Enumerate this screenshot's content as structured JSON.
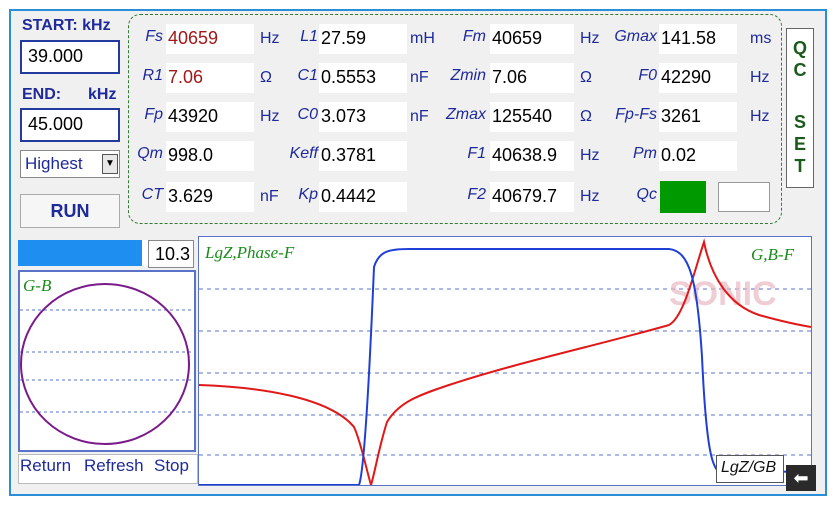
{
  "sweep": {
    "start_label": "START: kHz",
    "start_value": "39.000",
    "end_label": "END:",
    "end_unit": "kHz",
    "end_value": "45.000",
    "mode_selected": "Highest",
    "run_label": "RUN"
  },
  "params": [
    {
      "key": "fs",
      "label": "Fs",
      "value": "40659",
      "unit": "Hz"
    },
    {
      "key": "r1",
      "label": "R1",
      "value": "7.06",
      "unit": "Ω"
    },
    {
      "key": "fp",
      "label": "Fp",
      "value": "43920",
      "unit": "Hz"
    },
    {
      "key": "qm",
      "label": "Qm",
      "value": "998.0",
      "unit": ""
    },
    {
      "key": "ct",
      "label": "CT",
      "value": "3.629",
      "unit": "nF"
    },
    {
      "key": "l1",
      "label": "L1",
      "value": "27.59",
      "unit": "mH"
    },
    {
      "key": "c1",
      "label": "C1",
      "value": "0.5553",
      "unit": "nF"
    },
    {
      "key": "c0",
      "label": "C0",
      "value": "3.073",
      "unit": "nF"
    },
    {
      "key": "keff",
      "label": "Keff",
      "value": "0.3781",
      "unit": ""
    },
    {
      "key": "kp",
      "label": "Kp",
      "value": "0.4442",
      "unit": ""
    },
    {
      "key": "fm",
      "label": "Fm",
      "value": "40659",
      "unit": "Hz"
    },
    {
      "key": "zmin",
      "label": "Zmin",
      "value": "7.06",
      "unit": "Ω"
    },
    {
      "key": "zmax",
      "label": "Zmax",
      "value": "125540",
      "unit": "Ω"
    },
    {
      "key": "f1",
      "label": "F1",
      "value": "40638.9",
      "unit": "Hz"
    },
    {
      "key": "f2",
      "label": "F2",
      "value": "40679.7",
      "unit": "Hz"
    },
    {
      "key": "gmax",
      "label": "Gmax",
      "value": "141.58",
      "unit": "ms"
    },
    {
      "key": "f0",
      "label": "F0",
      "value": "42290",
      "unit": "Hz"
    },
    {
      "key": "fpfs",
      "label": "Fp-Fs",
      "value": "3261",
      "unit": "Hz"
    },
    {
      "key": "pm",
      "label": "Pm",
      "value": "0.02",
      "unit": ""
    },
    {
      "key": "qc",
      "label": "Qc",
      "value": "",
      "unit": ""
    }
  ],
  "qc_status_color": "#009900",
  "qc_set": {
    "line1": "Q",
    "line2": "C",
    "line3": "S",
    "line4": "E",
    "line5": "T"
  },
  "progress": {
    "fraction": 0.95,
    "value": "10.3"
  },
  "gb_panel": {
    "title": "G-B"
  },
  "graph": {
    "left_title": "LgZ,Phase-F",
    "right_title": "G,B-F",
    "watermark": "SONIC",
    "mode_button": "LgZ/GB"
  },
  "footer": {
    "return": "Return",
    "refresh": "Refresh",
    "stop": "Stop"
  },
  "colors": {
    "accent": "#2a8fd6",
    "label": "#1f2a9a",
    "lgz_curve": "#1f3fd6",
    "phase_curve": "#e01818",
    "gb_circle": "#7a1a8a"
  }
}
